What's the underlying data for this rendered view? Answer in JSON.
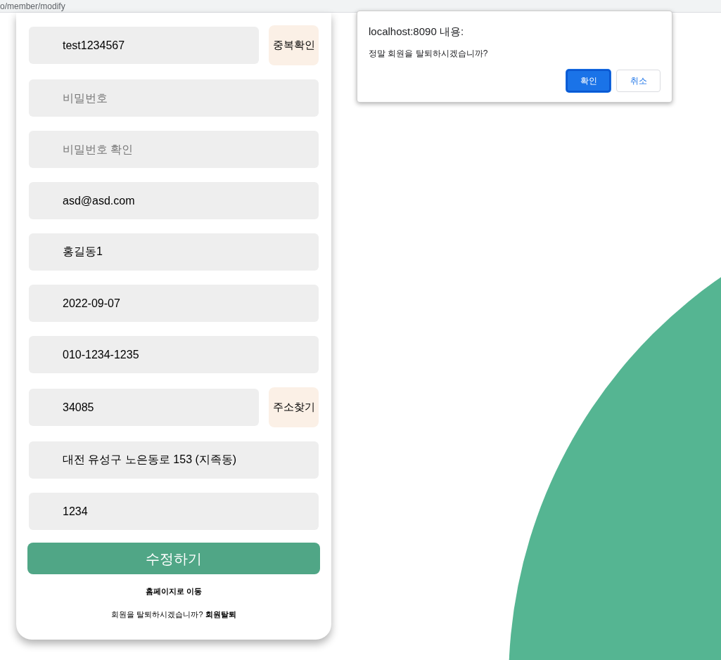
{
  "address_bar": {
    "url": "o/member/modify"
  },
  "form": {
    "fields": [
      {
        "value": "test1234567",
        "button": "중복확인"
      },
      {
        "placeholder": "비밀번호"
      },
      {
        "placeholder": "비밀번호 확인"
      },
      {
        "value": "asd@asd.com"
      },
      {
        "value": "홍길동1"
      },
      {
        "value": "2022-09-07"
      },
      {
        "value": "010-1234-1235"
      },
      {
        "value": "34085",
        "button": "주소찾기"
      },
      {
        "value": "대전 유성구 노은동로 153 (지족동)"
      },
      {
        "value": "1234"
      }
    ],
    "submit": "수정하기",
    "home_link": "홈페이지로 이동",
    "withdraw_text": "회원을 탈퇴하시겠습니까?",
    "withdraw_link": "회원탈퇴"
  },
  "dialog": {
    "title": "localhost:8090 내용:",
    "message": "정말 회원을 탈퇴하시겠습니까?",
    "buttons": [
      {
        "label": "확인",
        "selected": true
      },
      {
        "label": "취소",
        "selected": false
      }
    ]
  }
}
